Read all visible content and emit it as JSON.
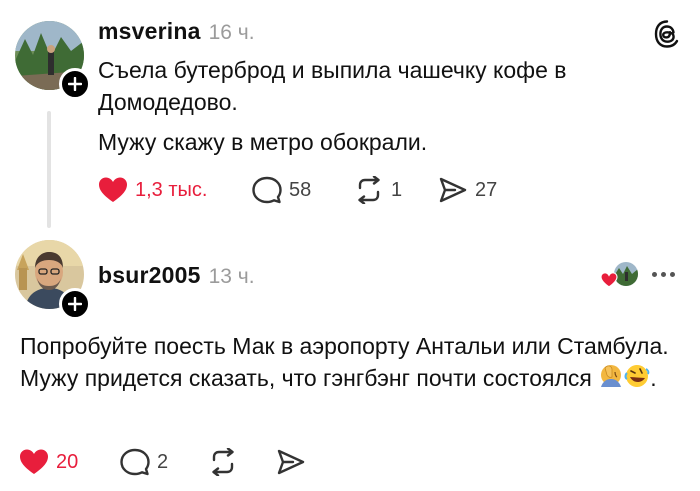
{
  "post": {
    "username": "msverina",
    "time": "16 ч.",
    "paragraph1": "Съела бутерброд и выпила чашечку кофе в Домодедово.",
    "paragraph2": "Мужу скажу в метро обокрали.",
    "likes": "1,3 тыс.",
    "comments": "58",
    "reposts": "1",
    "shares": "27"
  },
  "reply": {
    "username": "bsur2005",
    "time": "13 ч.",
    "text": "Попробуйте поесть Мак в аэропорту Антальи или Стамбула. Мужу придется сказать, что гэнгбэнг почти состоялся",
    "text_end": ".",
    "likes": "20",
    "comments": "2"
  },
  "icons": {
    "logo": "threads-logo-icon",
    "heart": "heart-icon",
    "comment": "comment-bubble-icon",
    "repost": "repost-icon",
    "share": "send-icon",
    "more": "more-options-icon",
    "add": "plus-icon",
    "emoji1": "face-palm-emoji",
    "emoji2": "rolling-laughing-emoji"
  },
  "colors": {
    "like": "#e81e3c",
    "muted": "#9b9b9b"
  }
}
